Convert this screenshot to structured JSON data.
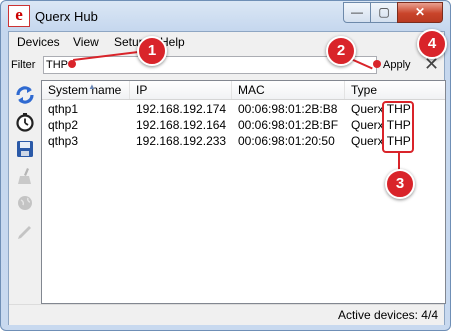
{
  "window": {
    "title": "Querx Hub",
    "minimize_glyph": "—",
    "maximize_glyph": "▢",
    "close_glyph": "✕",
    "logo_letter": "e"
  },
  "menu": [
    {
      "label": "Devices"
    },
    {
      "label": "View"
    },
    {
      "label": "Setup"
    },
    {
      "label": "Help"
    }
  ],
  "filter": {
    "label": "Filter",
    "value": "THP",
    "apply_label": "Apply",
    "clear_glyph": "✕"
  },
  "toolbar": {
    "icons": [
      "refresh-icon",
      "timer-icon",
      "save-icon",
      "clean-icon",
      "globe-icon",
      "edit-icon"
    ],
    "colors": {
      "refresh": "#2f6ad1",
      "save": "#2b5aa8",
      "disabled": "#b5b5b5"
    }
  },
  "table": {
    "columns": [
      "System name",
      "IP",
      "MAC",
      "Type"
    ],
    "sorted_column": "System name",
    "rows": [
      {
        "system_name": "qthp1",
        "ip": "192.168.192.174",
        "mac": "00:06:98:01:2B:B8",
        "type": "Querx THP"
      },
      {
        "system_name": "qthp2",
        "ip": "192.168.192.164",
        "mac": "00:06:98:01:2B:BF",
        "type": "Querx THP"
      },
      {
        "system_name": "qthp3",
        "ip": "192.168.192.233",
        "mac": "00:06:98:01:20:50",
        "type": "Querx THP"
      }
    ]
  },
  "status": {
    "text": "Active devices: 4/4"
  },
  "annotations": {
    "color": "#d9242a",
    "callouts": [
      "1",
      "2",
      "3",
      "4"
    ]
  }
}
